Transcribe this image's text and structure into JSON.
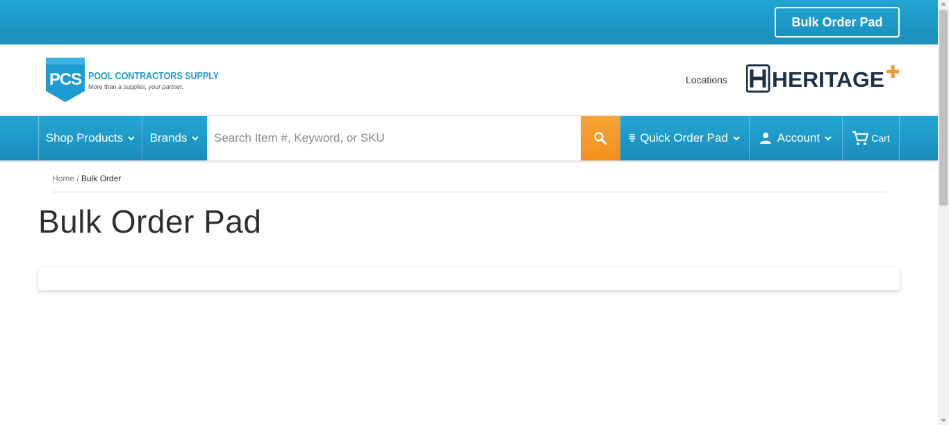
{
  "topbar": {
    "bulk_order_label": "Bulk Order Pad"
  },
  "header": {
    "logo": {
      "mark_text": "PCS",
      "brand_name": "POOL CONTRACTORS SUPPLY",
      "tagline_plain": "More than a supplier, ",
      "tagline_italic": "your partner."
    },
    "locations_label": "Locations",
    "partner_logo_text": "HERITAGE"
  },
  "nav": {
    "shop_products": "Shop Products",
    "brands": "Brands",
    "search_placeholder": "Search Item #, Keyword, or SKU",
    "quick_order_pad": "Quick Order Pad",
    "account": "Account",
    "cart": "Cart"
  },
  "breadcrumb": {
    "home": "Home",
    "separator": " / ",
    "current": "Bulk Order"
  },
  "page": {
    "title": "Bulk Order Pad"
  },
  "colors": {
    "brand_blue": "#1b8dbb",
    "accent_orange": "#f38f1c",
    "heritage_navy": "#1c3048"
  },
  "icons": {
    "search": "search-icon",
    "chevron": "chevron-down-icon",
    "quick_order": "list-icon",
    "account": "person-icon",
    "cart": "cart-icon"
  }
}
